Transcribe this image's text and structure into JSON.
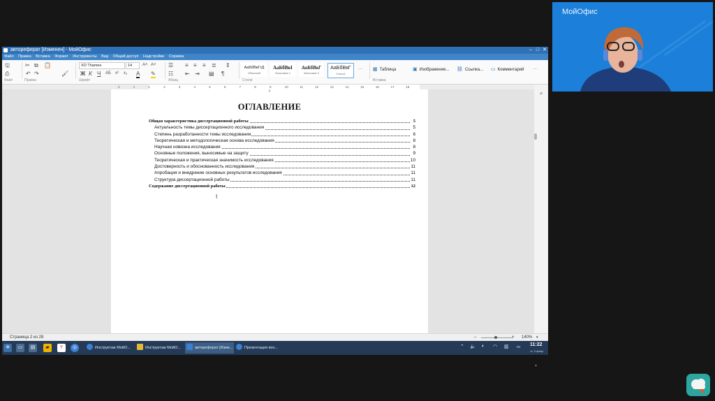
{
  "window": {
    "title": "автореферат [Изменен] - МойОфис",
    "controls": [
      "–",
      "□",
      "✕"
    ]
  },
  "menu": [
    "Файл",
    "Правка",
    "Вставка",
    "Формат",
    "Инструменты",
    "Вид",
    "Общий доступ",
    "Надстройки",
    "Справка"
  ],
  "ribbon": {
    "font_name": "XO Thames",
    "font_size": "14",
    "group_labels": {
      "file": "Файл",
      "edit": "Правка",
      "font": "Шрифт",
      "paragraph": "Абзац",
      "styles": "Стили",
      "insert": "Вставка"
    },
    "styles": [
      {
        "sample": "АаБбВвГгД",
        "name": "Обычный"
      },
      {
        "sample": "АаБбВвІ",
        "name": "Заголовок 1"
      },
      {
        "sample": "АаБбВвГ",
        "name": "Заголовок 2"
      },
      {
        "sample": "АаБбВвГ",
        "name": "Стиль1"
      }
    ],
    "insert": {
      "table": "Таблица",
      "image": "Изображение...",
      "link": "Ссылка...",
      "comment": "Комментарий"
    },
    "more": "···"
  },
  "ruler": {
    "numbers": [
      "2",
      "1",
      "1",
      "2",
      "3",
      "4",
      "5",
      "6",
      "7",
      "8",
      "9",
      "10",
      "11",
      "12",
      "13",
      "14",
      "15",
      "16",
      "17",
      "18"
    ]
  },
  "document": {
    "page_number": "2",
    "heading": "ОГЛАВЛЕНИЕ",
    "toc": [
      {
        "text": "Общая характеристика диссертационной работы",
        "page": "5",
        "level": 1
      },
      {
        "text": "Актуальность темы диссертационного исследования",
        "page": "5",
        "level": 2
      },
      {
        "text": "Степень разработанности темы исследования",
        "page": "6",
        "level": 2
      },
      {
        "text": "Теоретическая и  методологическая основа исследования",
        "page": "8",
        "level": 2
      },
      {
        "text": "Научная новизна исследования",
        "page": "8",
        "level": 2
      },
      {
        "text": "Основные положения, выносимые на защиту",
        "page": "9",
        "level": 2
      },
      {
        "text": "Теоретическая и практическая значимость исследования",
        "page": "10",
        "level": 2
      },
      {
        "text": "Достоверность и обоснованность исследования",
        "page": "11",
        "level": 2
      },
      {
        "text": "Апробация и внедрение основных результатов исследования",
        "page": "11",
        "level": 2
      },
      {
        "text": "Структура диссертационной работы",
        "page": "11",
        "level": 2
      },
      {
        "text": "Содержание диссертационной работы",
        "page": "12",
        "level": 1
      }
    ]
  },
  "status": {
    "page_info": "Страница 2 из 28",
    "zoom": "140%",
    "zoom_minus": "–",
    "zoom_plus": "+"
  },
  "taskbar": {
    "tasks": [
      {
        "label": "Инструктаж МойО...",
        "color": "#3d7fd1"
      },
      {
        "label": "Инструктаж МойО...",
        "color": "#e5b83a"
      },
      {
        "label": "автореферат [Изме...",
        "color": "#3d7fd1"
      },
      {
        "label": "Презентация вхо...",
        "color": "#3d7fd1"
      }
    ],
    "lang": "ru",
    "time": "11:22",
    "date": "чт, 3 февр."
  },
  "webcam": {
    "brand": "МойОфис"
  }
}
